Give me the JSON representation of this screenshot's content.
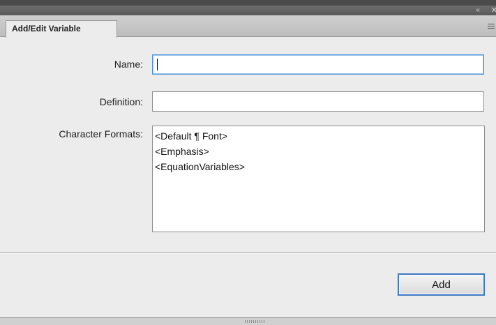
{
  "titlebar": {
    "collapse_icon": "double-chevron-left-icon",
    "collapse_glyph": "‹‹",
    "close_icon": "close-icon",
    "close_glyph": "✕"
  },
  "tab": {
    "label": "Add/Edit Variable",
    "menu_icon": "panel-menu-icon"
  },
  "form": {
    "name_label": "Name:",
    "name_value": "",
    "definition_label": "Definition:",
    "definition_value": "",
    "character_formats_label": "Character Formats:",
    "character_formats": [
      "<Default ¶ Font>",
      "<Emphasis>",
      "<EquationVariables>"
    ]
  },
  "actions": {
    "add_label": "Add"
  },
  "colors": {
    "focus_border": "#4a90d9",
    "button_border": "#3d78c6",
    "panel_bg": "#ececec",
    "titlebar_bg": "#595959"
  }
}
